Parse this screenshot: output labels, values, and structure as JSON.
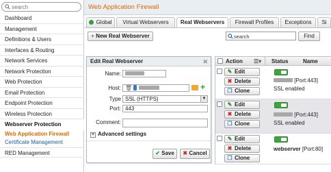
{
  "sidebar": {
    "search_placeholder": "search",
    "items": [
      {
        "label": "Dashboard"
      },
      {
        "label": "Management"
      },
      {
        "label": "Definitions & Users"
      },
      {
        "label": "Interfaces & Routing"
      },
      {
        "label": "Network Services"
      },
      {
        "label": "Network Protection"
      },
      {
        "label": "Web Protection"
      },
      {
        "label": "Email Protection"
      },
      {
        "label": "Endpoint Protection"
      },
      {
        "label": "Wireless Protection"
      }
    ],
    "section": "Webserver Protection",
    "active": "Web Application Firewall",
    "sub": "Certificate Management",
    "bottom": "RED Management"
  },
  "header": {
    "title": "Web Application Firewall"
  },
  "tabs": [
    "Global",
    "Virtual Webservers",
    "Real Webservers",
    "Firewall Profiles",
    "Exceptions",
    "Si"
  ],
  "toolbar": {
    "new_label": "New Real Webserver",
    "search_value": "search",
    "find_label": "Find"
  },
  "dialog": {
    "title": "Edit Real Webserver",
    "name_label": "Name:",
    "host_label": "Host:",
    "type_label": "Type",
    "type_value": "SSL (HTTPS)",
    "port_label": "Port:",
    "port_value": "443",
    "comment_label": "Comment:",
    "advanced_label": "Advanced settings",
    "save_label": "Save",
    "cancel_label": "Cancel"
  },
  "table": {
    "col_action": "Action",
    "col_status": "Status",
    "col_name": "Name",
    "edit_label": "Edit",
    "delete_label": "Delete",
    "clone_label": "Clone",
    "rows": [
      {
        "port": "[Port:443]",
        "sub": "SSL enabled",
        "name": ""
      },
      {
        "port": "[Port:443]",
        "sub": "SSL enabled",
        "name": ""
      },
      {
        "port": "[Port:80]",
        "sub": "",
        "name": "webserver"
      }
    ]
  },
  "colors": {
    "accent": "#e06a00",
    "link": "#1a5aa6",
    "ok": "#3ea43e",
    "danger": "#cc2a2a"
  }
}
